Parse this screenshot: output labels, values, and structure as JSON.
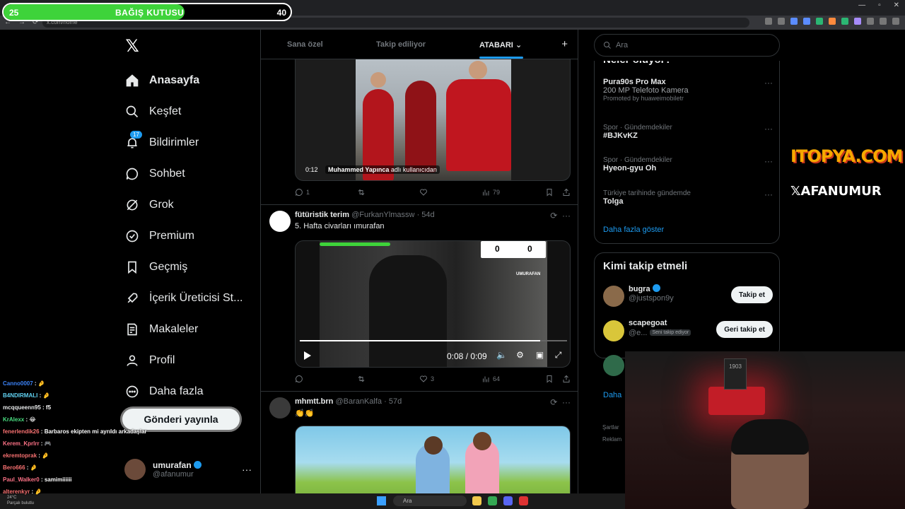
{
  "donation": {
    "start_value": "25",
    "title": "BAĞIŞ KUTUSU",
    "end_value": "40",
    "progress_fraction": 0.63,
    "fill_color": "#3ed33a"
  },
  "browser": {
    "url": "x.com/home"
  },
  "nav": {
    "logo": "𝕏",
    "items": [
      {
        "label": "Anasayfa",
        "icon": "home-icon",
        "active": true
      },
      {
        "label": "Keşfet",
        "icon": "search-icon"
      },
      {
        "label": "Bildirimler",
        "icon": "bell-icon",
        "badge": "17"
      },
      {
        "label": "Sohbet",
        "icon": "chat-icon"
      },
      {
        "label": "Grok",
        "icon": "grok-icon"
      },
      {
        "label": "Premium",
        "icon": "premium-icon"
      },
      {
        "label": "Geçmiş",
        "icon": "bookmark-icon"
      },
      {
        "label": "İçerik Üreticisi St...",
        "icon": "rocket-icon"
      },
      {
        "label": "Makaleler",
        "icon": "article-icon"
      },
      {
        "label": "Profil",
        "icon": "person-icon"
      },
      {
        "label": "Daha fazla",
        "icon": "more-circle-icon"
      }
    ],
    "post_button": "Gönderi yayınla",
    "account": {
      "name": "umurafan",
      "handle": "@afanumur",
      "more": "···"
    }
  },
  "chat": [
    {
      "user": "Canno0007",
      "msg": "🤌",
      "color": "#3b82f6"
    },
    {
      "user": "B4NDIRMALI",
      "msg": "🤌",
      "color": "#60d0f0"
    },
    {
      "user": "mcqqueenn95",
      "msg": "f5",
      "color": "#e7e9ea"
    },
    {
      "user": "KrAlexx",
      "msg": "😂",
      "color": "#4ade80"
    },
    {
      "user": "fenerlendik26",
      "msg": "Barbaros ekipten mi ayrıldı arkadaşlar",
      "color": "#f87171"
    },
    {
      "user": "Kerem_Kprlrr",
      "msg": "🎮",
      "color": "#fb7185"
    },
    {
      "user": "ekremtoprak",
      "msg": "🤌",
      "color": "#f87171"
    },
    {
      "user": "Bero666",
      "msg": "🤌",
      "color": "#f87171"
    },
    {
      "user": "Paul_Walker0",
      "msg": "samimiiiiii",
      "color": "#fb7185"
    },
    {
      "user": "alterenkyr",
      "msg": "🤌",
      "color": "#f87171"
    }
  ],
  "timeline": {
    "tabs": [
      "Sana özel",
      "Takip ediliyor",
      "ATABARI"
    ],
    "active_tab": "ATABARI",
    "tab_dropdown": "⌄",
    "add_tab": "+",
    "tweet1": {
      "video_time": "0:12",
      "credit_name": "Muhammed Yapıncа",
      "credit_suffix": "adlı kullanıcıdan",
      "replies": "1",
      "retweets": "",
      "likes": "",
      "views": "79"
    },
    "tweet2": {
      "name": "fütüristik terim",
      "handle": "@FurkanYlmassw",
      "time": "54d",
      "text": "5. Hafta civarları ımurafan",
      "video_time": "0:08 / 0:09",
      "video_progress_fraction": 0.9,
      "score_home": "0",
      "score_away": "0",
      "watermark": "UMURAFAN",
      "replies": "",
      "retweets": "",
      "likes": "3",
      "views": "64"
    },
    "tweet3": {
      "name": "mhmtt.brn",
      "handle": "@BaranKalfa",
      "time": "57d",
      "text": "👏👏"
    }
  },
  "right": {
    "search_placeholder": "Ara",
    "trends_title": "Neler oluyor?",
    "trends": [
      {
        "meta": "",
        "name": "Pura90s Pro Max",
        "sub": "200 MP Telefoto Kamera",
        "promo": "Promoted by huaweimobiletr"
      },
      {
        "meta": "Spor · Gündemdekiler",
        "name": "#BJKvKZ",
        "sub": "",
        "promo": ""
      },
      {
        "meta": "Spor · Gündemdekiler",
        "name": "Hyeon-gyu Oh",
        "sub": "",
        "promo": ""
      },
      {
        "meta": "Türkiye tarihinde gündemde",
        "name": "Tolga",
        "sub": "",
        "promo": ""
      }
    ],
    "show_more": "Daha fazla göster",
    "who_title": "Kimi takip etmeli",
    "who": [
      {
        "name": "bugra",
        "handle": "@justspon9y",
        "button": "Takip et",
        "badge": ""
      },
      {
        "name": "scapegoat",
        "handle": "@e...",
        "button": "Geri takip et",
        "badge": "Seni takip ediyor"
      },
      {
        "name": "",
        "handle": "",
        "button": "",
        "badge": ""
      }
    ],
    "who_more": "Daha",
    "footer": [
      "Şartlar",
      "Reklam"
    ]
  },
  "overlay": {
    "brand1": "ITOPYA.COM",
    "brand2": "𝕏AFANUMUR",
    "cam_sign": "1903"
  },
  "taskbar": {
    "weather_temp": "24°C",
    "weather_desc": "Parçalı bulutlu",
    "search": "Ara"
  }
}
